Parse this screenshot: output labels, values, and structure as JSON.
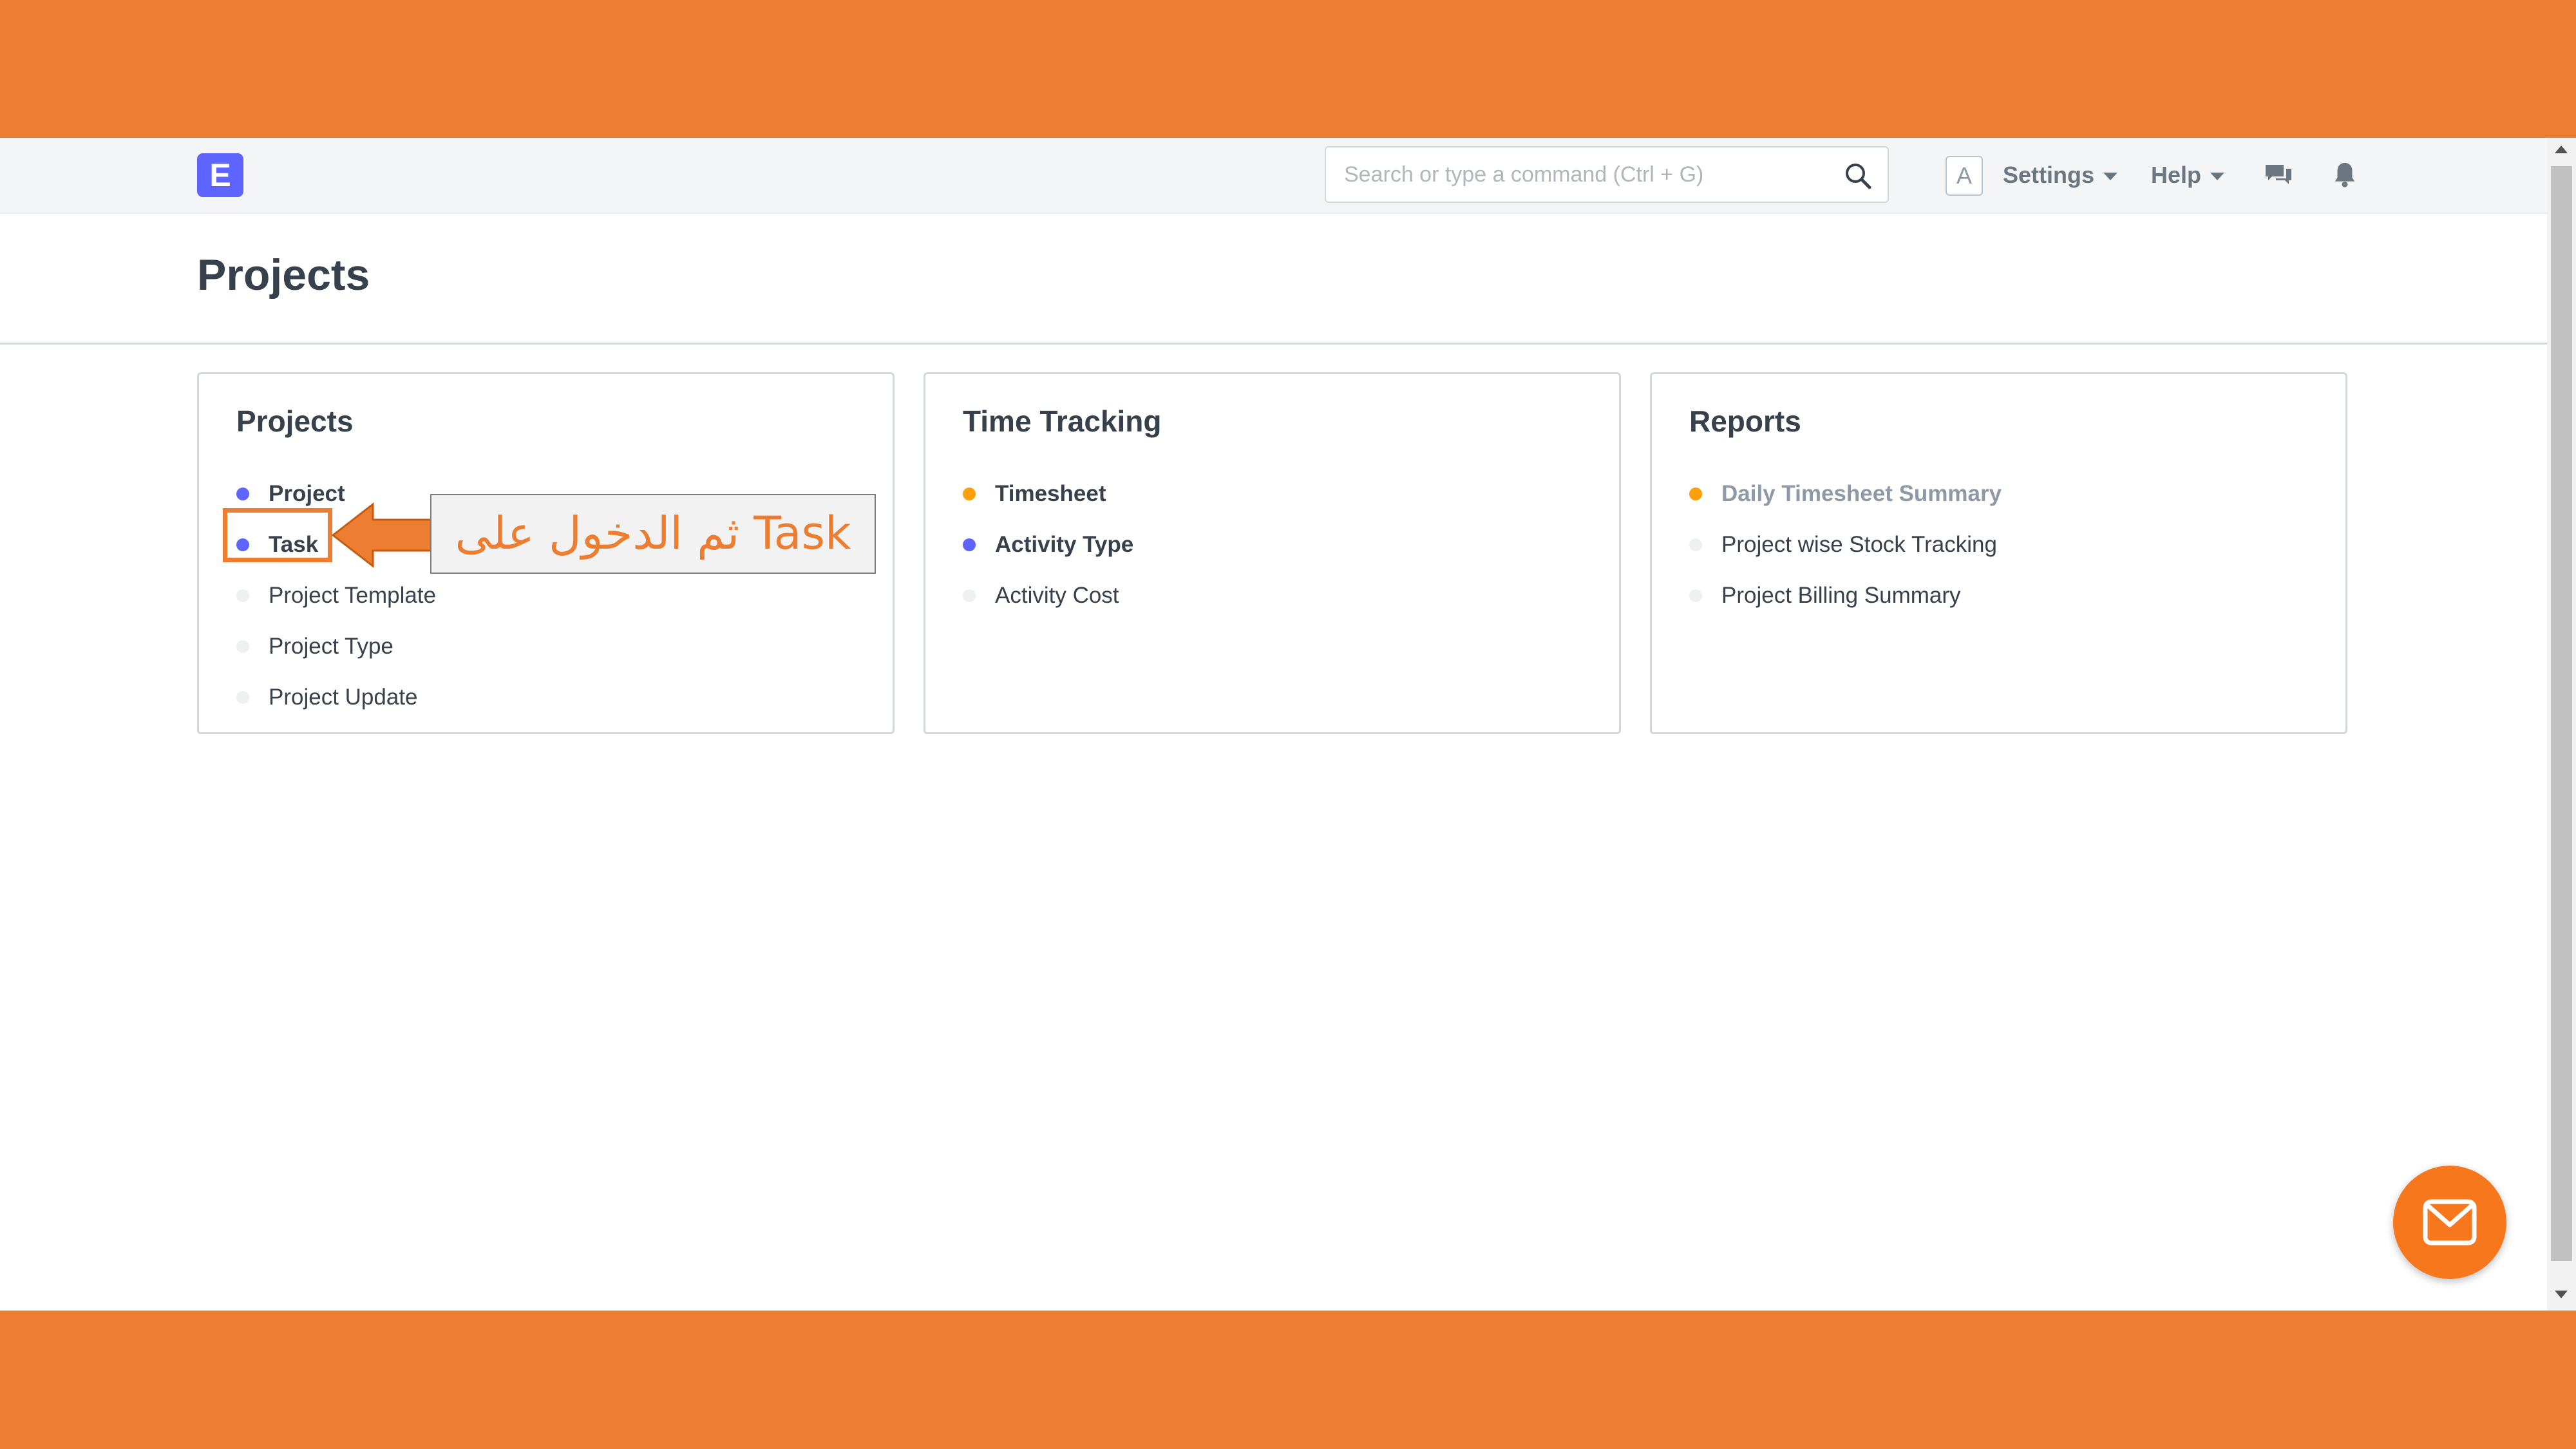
{
  "navbar": {
    "logo_letter": "E",
    "search_placeholder": "Search or type a command (Ctrl + G)",
    "avatar_letter": "A",
    "settings_label": "Settings",
    "help_label": "Help"
  },
  "page": {
    "title": "Projects"
  },
  "cards": {
    "projects": {
      "title": "Projects",
      "links": [
        "Project",
        "Task",
        "Project Template",
        "Project Type",
        "Project Update"
      ]
    },
    "time_tracking": {
      "title": "Time Tracking",
      "links": [
        "Timesheet",
        "Activity Type",
        "Activity Cost"
      ]
    },
    "reports": {
      "title": "Reports",
      "links": [
        "Daily Timesheet Summary",
        "Project wise Stock Tracking",
        "Project Billing Summary"
      ]
    }
  },
  "annotation": {
    "callout_text": "ثم الدخول على Task"
  },
  "colors": {
    "accent_orange": "#ED7D31",
    "brand_blue": "#5E64FF",
    "dot_orange": "#FFA00A",
    "dot_inactive": "#EEF0F2",
    "fab_orange": "#F7781C"
  },
  "icons": [
    "search-icon",
    "caret-down-icon",
    "chat-icon",
    "bell-icon",
    "envelope-icon",
    "arrow-left-icon"
  ]
}
